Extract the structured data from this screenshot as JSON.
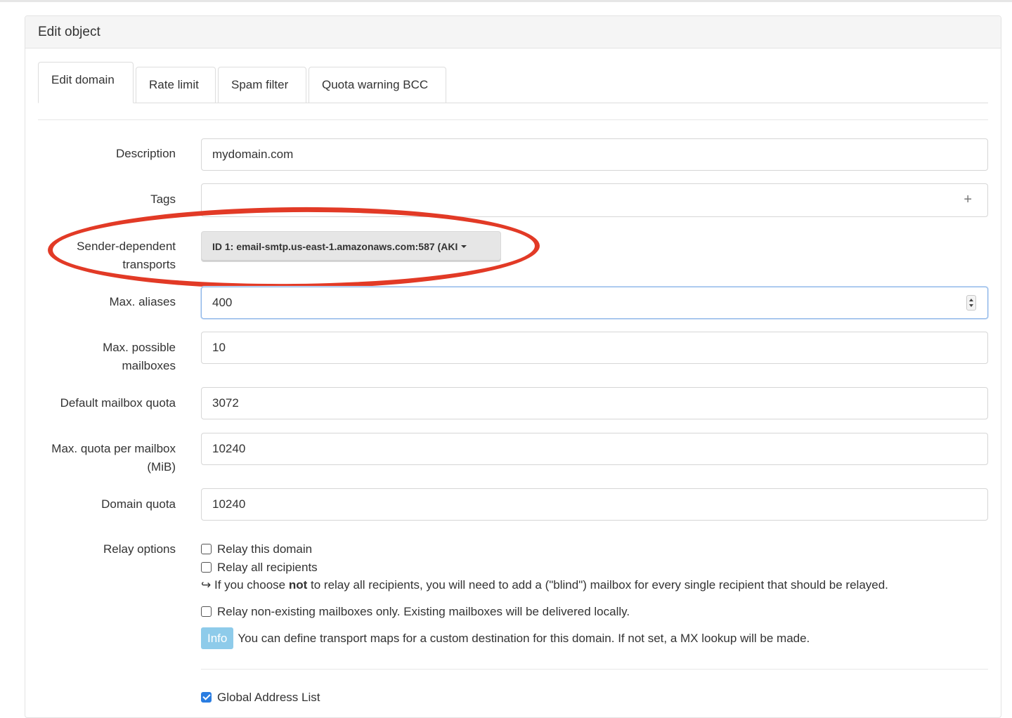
{
  "panel": {
    "title": "Edit object"
  },
  "tabs": [
    {
      "label": "Edit domain",
      "active": true
    },
    {
      "label": "Rate limit",
      "active": false
    },
    {
      "label": "Spam filter",
      "active": false
    },
    {
      "label": "Quota warning BCC",
      "active": false
    }
  ],
  "form": {
    "description": {
      "label": "Description",
      "value": "mydomain.com"
    },
    "tags": {
      "label": "Tags",
      "value": "",
      "add_icon": "+"
    },
    "sender_transports": {
      "label_line1": "Sender-dependent",
      "label_line2": "transports",
      "selected": "ID 1: email-smtp.us-east-1.amazonaws.com:587 (AKI"
    },
    "max_aliases": {
      "label": "Max. aliases",
      "value": "400"
    },
    "max_mailboxes": {
      "label_line1": "Max. possible",
      "label_line2": "mailboxes",
      "value": "10"
    },
    "default_quota": {
      "label": "Default mailbox quota",
      "value": "3072"
    },
    "max_quota": {
      "label_line1": "Max. quota per mailbox",
      "label_line2": "(MiB)",
      "value": "10240"
    },
    "domain_quota": {
      "label": "Domain quota",
      "value": "10240"
    },
    "relay": {
      "label": "Relay options",
      "relay_domain": "Relay this domain",
      "relay_all": "Relay all recipients",
      "hint_arrow": "↪",
      "hint_prefix": "If you choose",
      "hint_bold": "not",
      "hint_suffix": "to relay all recipients, you will need to add a (\"blind\") mailbox for every single recipient that should be relayed.",
      "relay_unknown": "Relay non-existing mailboxes only. Existing mailboxes will be delivered locally.",
      "info_badge": "Info",
      "info_text": "You can define transport maps for a custom destination for this domain. If not set, a MX lookup will be made."
    },
    "gal": {
      "label": "Global Address List",
      "checked": true
    }
  },
  "colors": {
    "highlight": "#e23a26",
    "info_badge": "#8ecbea",
    "focus_border": "#8ab4e8"
  }
}
